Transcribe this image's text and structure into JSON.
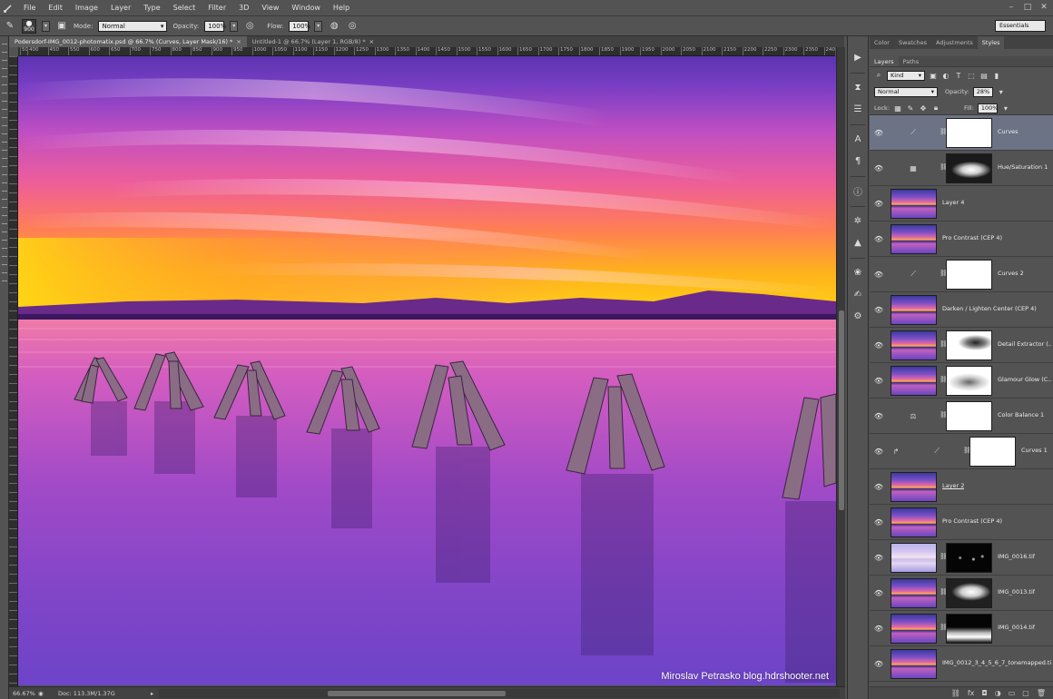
{
  "menu": [
    "File",
    "Edit",
    "Image",
    "Layer",
    "Type",
    "Select",
    "Filter",
    "3D",
    "View",
    "Window",
    "Help"
  ],
  "window_controls": [
    "–",
    "□",
    "✕"
  ],
  "options": {
    "brush_size": "900",
    "mode_label": "Mode:",
    "mode_value": "Normal",
    "opacity_label": "Opacity:",
    "opacity_value": "100%",
    "flow_label": "Flow:",
    "flow_value": "100%",
    "workspace": "Essentials"
  },
  "tabs": [
    {
      "label": "Podersdorf-IMG_0012-photomatix.psd @ 66.7% (Curves, Layer Mask/16) *",
      "active": true
    },
    {
      "label": "Untitled-1 @ 66.7% (Layer 1, RGB/8) *",
      "active": false
    }
  ],
  "ruler_ticks": [
    "50",
    "400",
    "450",
    "550",
    "600",
    "650",
    "700",
    "750",
    "800",
    "850",
    "900",
    "950",
    "1000",
    "1050",
    "1100",
    "1150",
    "1200",
    "1250",
    "1300",
    "1350",
    "1400",
    "1450",
    "1500",
    "1550",
    "1600",
    "1650",
    "1700",
    "1750",
    "1800",
    "1850",
    "1900",
    "1950",
    "2000",
    "2050",
    "2100",
    "2150",
    "2200",
    "2250",
    "2300",
    "2350",
    "2400"
  ],
  "watermark": "Miroslav  Petrasko  blog.hdrshooter.net",
  "status": {
    "zoom": "66.67%",
    "doc": "Doc: 113.3M/1.37G"
  },
  "panel_tabs_top": [
    "Color",
    "Swatches",
    "Adjustments",
    "Styles"
  ],
  "panel_tabs_layers": [
    "Layers",
    "Paths"
  ],
  "layers_panel": {
    "kind": "Kind",
    "blend": "Normal",
    "opacity_label": "Opacity:",
    "opacity": "28%",
    "lock_label": "Lock:",
    "fill_label": "Fill:",
    "fill": "100%"
  },
  "layers": [
    {
      "name": "Curves",
      "type": "curves",
      "mask": "white",
      "selected": true
    },
    {
      "name": "Hue/Saturation 1",
      "type": "huesat",
      "mask": "dark-cloud"
    },
    {
      "name": "Layer 4",
      "type": "image",
      "thumb": "normal"
    },
    {
      "name": "Pro Contrast (CEP 4)",
      "type": "image",
      "thumb": "normal"
    },
    {
      "name": "Curves 2",
      "type": "curves",
      "mask": "white"
    },
    {
      "name": "Darken / Lighten Center (CEP 4)",
      "type": "image",
      "thumb": "normal"
    },
    {
      "name": "Detail Extractor (...",
      "type": "image-mask",
      "thumb": "normal",
      "mask": "light-cloud"
    },
    {
      "name": "Glamour Glow (C...",
      "type": "image-mask",
      "thumb": "normal",
      "mask": "light-cloud2"
    },
    {
      "name": "Color Balance 1",
      "type": "balance",
      "mask": "white"
    },
    {
      "name": "Curves 1",
      "type": "curves-clip",
      "mask": "white"
    },
    {
      "name": "Layer 2",
      "type": "image",
      "thumb": "normal",
      "underline": true
    },
    {
      "name": "Pro Contrast (CEP 4)",
      "type": "image",
      "thumb": "normal"
    },
    {
      "name": "IMG_0016.tif",
      "type": "image-mask",
      "thumb": "pale",
      "mask": "black-dots"
    },
    {
      "name": "IMG_0013.tif",
      "type": "image-mask",
      "thumb": "normal",
      "mask": "dark-cloud2"
    },
    {
      "name": "IMG_0014.tif",
      "type": "image-mask",
      "thumb": "normal",
      "mask": "dark-band"
    },
    {
      "name": "IMG_0012_3_4_5_6_7_tonemapped.tif",
      "type": "image",
      "thumb": "normal"
    }
  ],
  "colors": {
    "ui_bg": "#535353",
    "panel_selected": "#6b7385",
    "sky_top": "#6a3fb8",
    "sunset_orange": "#ffa21f",
    "water_magenta": "#d35fbf"
  }
}
